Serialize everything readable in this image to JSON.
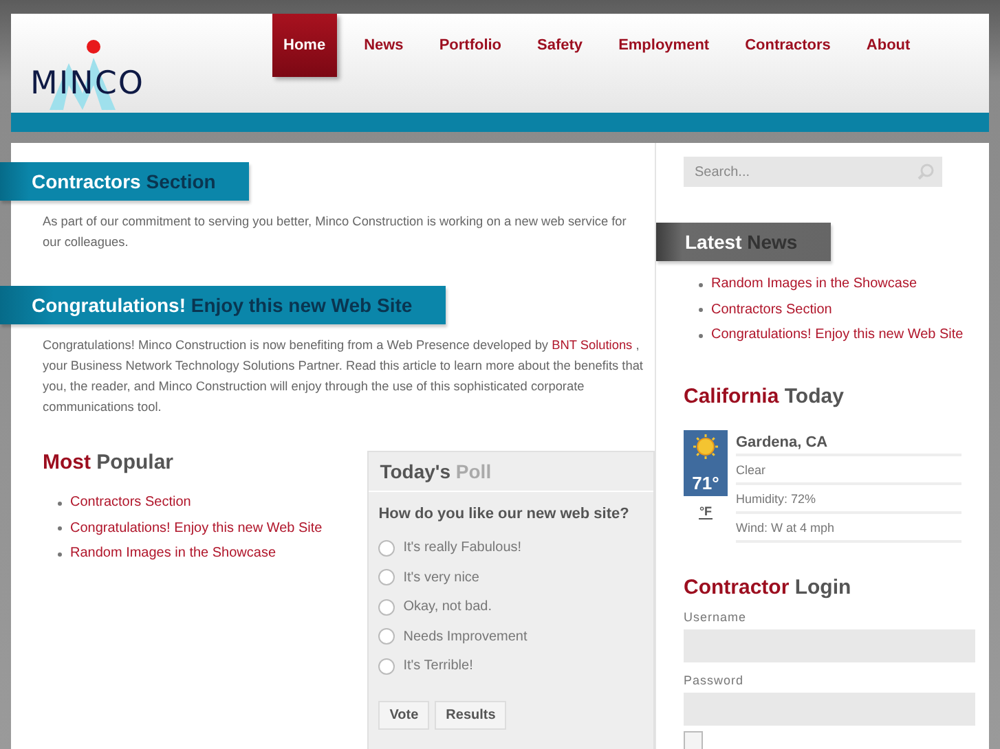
{
  "logo": {
    "text": "MINCO"
  },
  "nav": [
    {
      "label": "Home",
      "selected": true
    },
    {
      "label": "News",
      "selected": false
    },
    {
      "label": "Portfolio",
      "selected": false
    },
    {
      "label": "Safety",
      "selected": false
    },
    {
      "label": "Employment",
      "selected": false
    },
    {
      "label": "Contractors",
      "selected": false
    },
    {
      "label": "About",
      "selected": false
    }
  ],
  "articles": [
    {
      "heading": {
        "lead": "Contractors",
        "rest": "Section"
      },
      "text_before": "As part of our commitment to serving you better, Minco Construction is working on a new web service for our colleagues."
    },
    {
      "heading": {
        "lead": "Congratulations!",
        "rest": "Enjoy this new Web Site"
      },
      "text_before": "Congratulations! Minco Construction is now benefiting from a Web Presence developed by",
      "link": "BNT Solutions",
      "text_after": ", your Business Network Technology Solutions Partner. Read this article to learn more about the benefits that you, the reader, and Minco Construction will enjoy through the use of this sophisticated corporate communications tool."
    }
  ],
  "most_popular": {
    "heading": {
      "lead": "Most",
      "rest": "Popular"
    },
    "items": [
      "Contractors Section",
      "Congratulations! Enjoy this new Web Site",
      "Random Images in the Showcase"
    ]
  },
  "poll": {
    "heading": {
      "lead": "Today's",
      "rest": "Poll"
    },
    "question": "How do you like our new web site?",
    "options": [
      {
        "label": "It's really Fabulous!",
        "selected": false
      },
      {
        "label": "It's very nice",
        "selected": false
      },
      {
        "label": "Okay, not bad.",
        "selected": false
      },
      {
        "label": "Needs Improvement",
        "selected": false
      },
      {
        "label": "It's Terrible!",
        "selected": false
      }
    ],
    "buttons": [
      "Vote",
      "Results"
    ]
  },
  "search": {
    "placeholder": "Search..."
  },
  "latest_news": {
    "heading": {
      "lead": "Latest",
      "rest": "News"
    },
    "items": [
      "Random Images in the Showcase",
      "Contractors Section",
      "Congratulations! Enjoy this new Web Site"
    ]
  },
  "weather": {
    "heading": {
      "lead": "California",
      "rest": "Today"
    },
    "temperature": "71°",
    "unit": "°F",
    "location": "Gardena, CA",
    "details": [
      "Clear",
      "Humidity: 72%",
      "Wind: W at 4 mph"
    ]
  },
  "login": {
    "heading": {
      "lead": "Contractor",
      "rest": "Login"
    },
    "fields": [
      "Username",
      "Password"
    ],
    "remember_checked": false
  }
}
